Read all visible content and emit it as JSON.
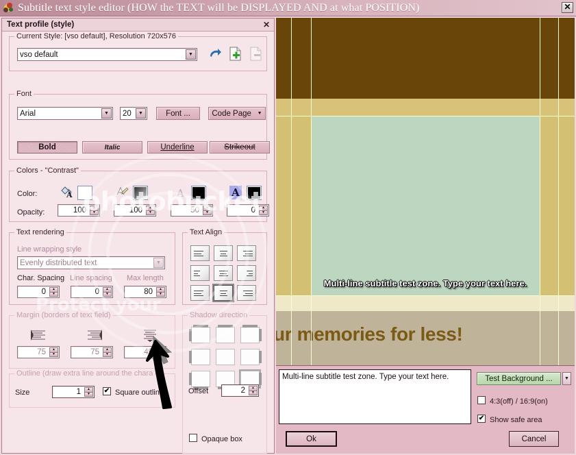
{
  "window": {
    "title": "Subtitle text style editor  (HOW the TEXT will be DISPLAYED AND at what POSITION)",
    "close_label": "✕",
    "icon": "butterfly-icon"
  },
  "panel": {
    "title": "Text profile (style)",
    "close_label": "✕"
  },
  "current_style": {
    "legend": "Current Style: [vso default], Resolution 720x576",
    "value": "vso default",
    "buttons": [
      {
        "name": "load-style-button",
        "icon": "open-folder-icon"
      },
      {
        "name": "add-style-button",
        "icon": "add-page-icon"
      },
      {
        "name": "remove-style-button",
        "icon": "remove-page-icon"
      }
    ]
  },
  "font": {
    "legend": "Font",
    "family": "Arial",
    "size": "20",
    "font_button": "Font ...",
    "code_page_button": "Code Page",
    "styles": [
      {
        "label": "Bold",
        "active": true
      },
      {
        "label": "Italic",
        "active": false
      },
      {
        "label": "Underline",
        "active": false
      },
      {
        "label": "Strikeout",
        "active": false
      }
    ]
  },
  "colors": {
    "legend": "Colors - \"Contrast\"",
    "color_label": "Color:",
    "opacity_label": "Opacity:",
    "swatches": [
      {
        "name": "fill-color-swatch",
        "icon": "bucket-fill-a-icon",
        "color": "#ffffff"
      },
      {
        "name": "outline-color-swatch",
        "icon": "pen-a-icon",
        "color": "#808080"
      },
      {
        "name": "shadow-color-swatch",
        "icon": "grey-a-icon",
        "color": "#000000"
      },
      {
        "name": "background-color-swatch",
        "icon": "highlight-a-icon",
        "color": "#000000"
      }
    ],
    "opacities": [
      "100",
      "100",
      "50",
      "0"
    ]
  },
  "text_rendering": {
    "legend": "Text rendering",
    "line_wrapping_label": "Line wrapping style",
    "line_wrapping_value": "Evenly distributed text",
    "char_spacing_label": "Char. Spacing",
    "char_spacing_value": "0",
    "line_spacing_label": "Line spacing",
    "line_spacing_value": "0",
    "max_length_label": "Max length",
    "max_length_value": "80"
  },
  "text_align": {
    "legend": "Text Align",
    "selected_index": 7,
    "cells": [
      "align-top-left",
      "align-top-center",
      "align-top-right",
      "align-middle-left",
      "align-middle-center",
      "align-middle-right",
      "align-bottom-left",
      "align-bottom-center",
      "align-bottom-right"
    ]
  },
  "margin": {
    "legend": "Margin  (borders of text field)",
    "values": [
      "75",
      "75",
      "49"
    ],
    "icons": [
      "margin-left-icon",
      "margin-right-icon",
      "margin-bottom-icon"
    ]
  },
  "outline": {
    "legend": "Outline  (draw extra line around the chara",
    "size_label": "Size",
    "size_value": "1",
    "square_outline_label": "Square outline",
    "square_outline_checked": true
  },
  "shadow": {
    "legend": "Shadow direction",
    "selected_index": 8,
    "offset_label": "Offset",
    "offset_value": "2",
    "opaque_box_label": "Opaque box",
    "opaque_box_checked": false
  },
  "preview": {
    "subtitle_text": "Multi-line subtitle test zone. Type your text here.",
    "background_slogan": "ur memories for less!",
    "colors": {
      "top_brown": "#684508",
      "tan_band": "#d8c277",
      "green_zone": "#bdd6c0",
      "cream_band": "#efe9c8",
      "grey_band": "#bfb39a",
      "safe_line": "#fdfbd0"
    }
  },
  "bottom": {
    "memo_text": "Multi-line subtitle test zone. Type your text here.",
    "test_background_button": "Test Background ...",
    "aspect_checkbox_label": "4:3(off) / 16:9(on)",
    "aspect_checked": false,
    "safe_area_checkbox_label": "Show safe area",
    "safe_area_checked": true,
    "ok_button": "Ok",
    "cancel_button": "Cancel"
  }
}
